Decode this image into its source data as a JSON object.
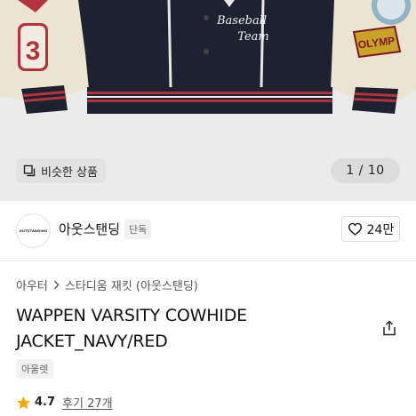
{
  "product_image": {
    "patch_left_text": "3",
    "patch_center_line1": "Baseball",
    "patch_center_line2": "Team",
    "patch_right_text": "OLYMP",
    "similar_button_label": "비슷한 상품",
    "image_counter": "1 / 10"
  },
  "brand": {
    "logo_text": "OUTSTANDING",
    "name": "아웃스탠딩",
    "exclusive_badge": "단독",
    "like_count": "24만"
  },
  "breadcrumb": {
    "items": [
      "아우터",
      "스타디움 재킷 (아웃스탠딩)"
    ]
  },
  "product": {
    "title": "WAPPEN VARSITY COWHIDE JACKET_NAVY/RED",
    "outlet_badge": "아울렛",
    "rating": "4.7",
    "reviews_label": "후기 27개"
  },
  "colors": {
    "accent_star": "#f2a900",
    "jacket_navy": "#1d2230",
    "sleeve_cream": "#ece4d3",
    "rib_red": "#b3323c"
  }
}
